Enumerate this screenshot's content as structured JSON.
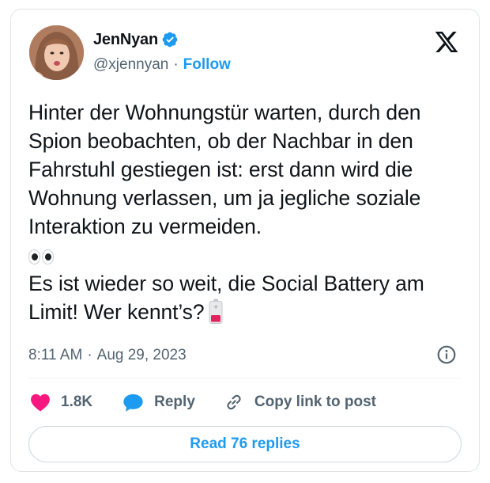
{
  "user": {
    "name": "JenNyan",
    "handle": "@xjennyan",
    "separator": "·",
    "follow_label": "Follow"
  },
  "tweet": {
    "paragraph1": "Hinter der Wohnungstür warten, durch den Spion beobachten, ob der Nachbar in den Fahrstuhl gestiegen ist: erst dann wird die Wohnung verlassen, um ja jegliche soziale Interaktion zu vermeiden.",
    "eyes_emoji": "👀",
    "paragraph2": "Es ist wieder so weit, die Social Battery am Limit! Wer kennt’s?",
    "battery_emoji": "🪫"
  },
  "meta": {
    "time": "8:11 AM",
    "separator": "·",
    "date": "Aug 29, 2023"
  },
  "actions": {
    "like_count": "1.8K",
    "reply_label": "Reply",
    "copy_label": "Copy link to post"
  },
  "read_replies_label": "Read 76 replies",
  "colors": {
    "accent": "#1d9bf0",
    "like": "#f91880",
    "reply_bubble": "#1d9bf0",
    "muted_text": "#536471",
    "main_text": "#0f1419",
    "border": "#cfd9de"
  },
  "icons": {
    "verified": "verified-badge-icon",
    "x_logo": "x-logo-icon",
    "info": "info-icon",
    "heart": "heart-icon",
    "reply": "reply-bubble-icon",
    "link": "link-icon"
  }
}
